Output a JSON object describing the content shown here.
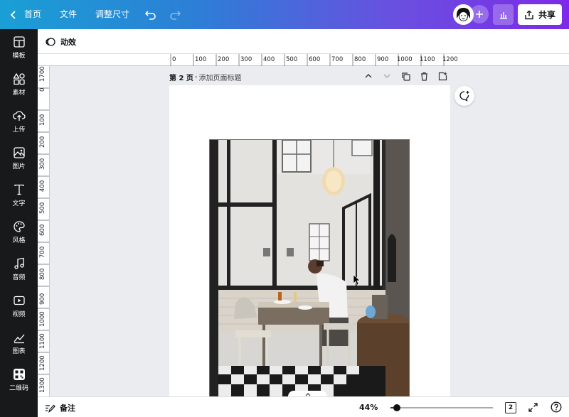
{
  "topbar": {
    "home_label": "首页",
    "file_label": "文件",
    "resize_label": "调整尺寸",
    "share_label": "共享",
    "icons": [
      "back-chevron-icon",
      "undo-icon",
      "redo-icon",
      "plus-icon",
      "insights-chart-icon",
      "share-upload-icon"
    ]
  },
  "sidebar": {
    "items": [
      {
        "label": "模板",
        "icon": "template-icon"
      },
      {
        "label": "素材",
        "icon": "elements-icon"
      },
      {
        "label": "上传",
        "icon": "upload-icon"
      },
      {
        "label": "图片",
        "icon": "photo-icon"
      },
      {
        "label": "文字",
        "icon": "text-icon"
      },
      {
        "label": "风格",
        "icon": "palette-icon"
      },
      {
        "label": "音频",
        "icon": "music-icon"
      },
      {
        "label": "视频",
        "icon": "video-icon"
      },
      {
        "label": "图表",
        "icon": "chart-icon"
      },
      {
        "label": "二维码",
        "icon": "qrcode-icon"
      }
    ]
  },
  "toolbar": {
    "animate_label": "动效"
  },
  "ruler": {
    "h_ticks": [
      "0",
      "100",
      "200",
      "300",
      "400",
      "500",
      "600",
      "700",
      "800",
      "900",
      "1000",
      "1100",
      "1200"
    ],
    "v_ticks": [
      "1700",
      "0",
      "100",
      "200",
      "300",
      "400",
      "500",
      "600",
      "700",
      "800",
      "900",
      "1000",
      "1100",
      "1200",
      "1300"
    ]
  },
  "page": {
    "number_label": "第 2 页",
    "separator": "-",
    "add_title_label": "添加页面标题"
  },
  "bottombar": {
    "notes_label": "备注",
    "zoom_label": "44%",
    "zoom_percent": 44,
    "page_count": "2"
  },
  "colors": {
    "selection": "#8b3dff",
    "sidebar_bg": "#18191b",
    "gradient_start": "#1a9fd5",
    "gradient_end": "#7d2ae8"
  }
}
